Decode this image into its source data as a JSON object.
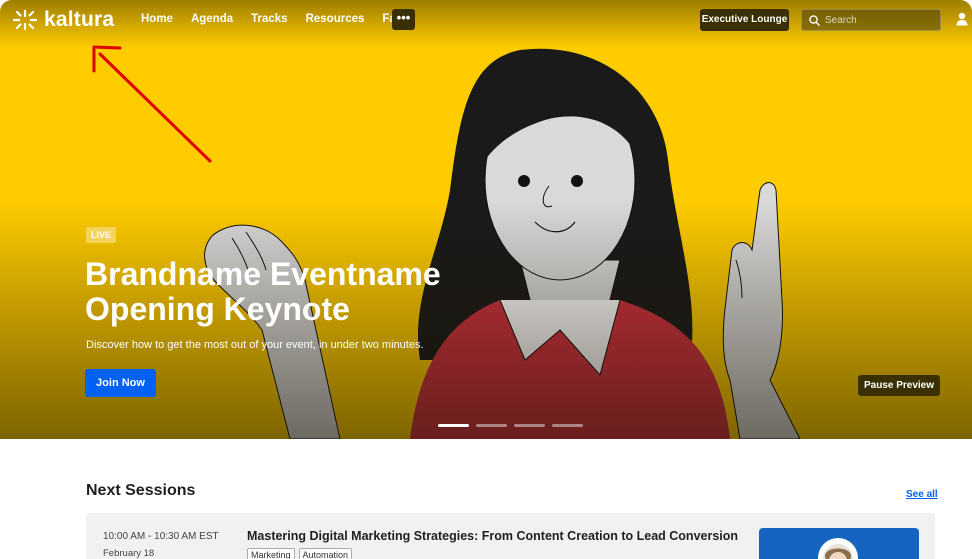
{
  "brand": {
    "logo_text": "kaltura",
    "logo_icon": "kaltura-sun-icon"
  },
  "nav": {
    "links": [
      "Home",
      "Agenda",
      "Tracks",
      "Resources",
      "Faq"
    ],
    "more_label": "•••",
    "executive_lounge": "Executive Lounge",
    "search_placeholder": "Search",
    "user_icon": "user-icon"
  },
  "hero": {
    "badge": "LIVE",
    "title_line1": "Brandname Eventname",
    "title_line2": "Opening Keynote",
    "subtitle": "Discover how to get the most out of your event, in under two minutes.",
    "join_button": "Join Now",
    "pause_button": "Pause Preview",
    "slide_count": 4,
    "active_slide": 1,
    "background_color": "#ffcc00"
  },
  "next_sessions": {
    "title": "Next Sessions",
    "see_all": "See all",
    "items": [
      {
        "time": "10:00 AM - 10:30 AM EST",
        "date": "February 18",
        "title": "Mastering Digital Marketing Strategies: From Content Creation to Lead Conversion",
        "tags": [
          "Marketing",
          "Automation"
        ]
      }
    ]
  },
  "colors": {
    "accent": "#0061f2",
    "dark_button": "#3a2f00",
    "annotation": "#e00000"
  }
}
